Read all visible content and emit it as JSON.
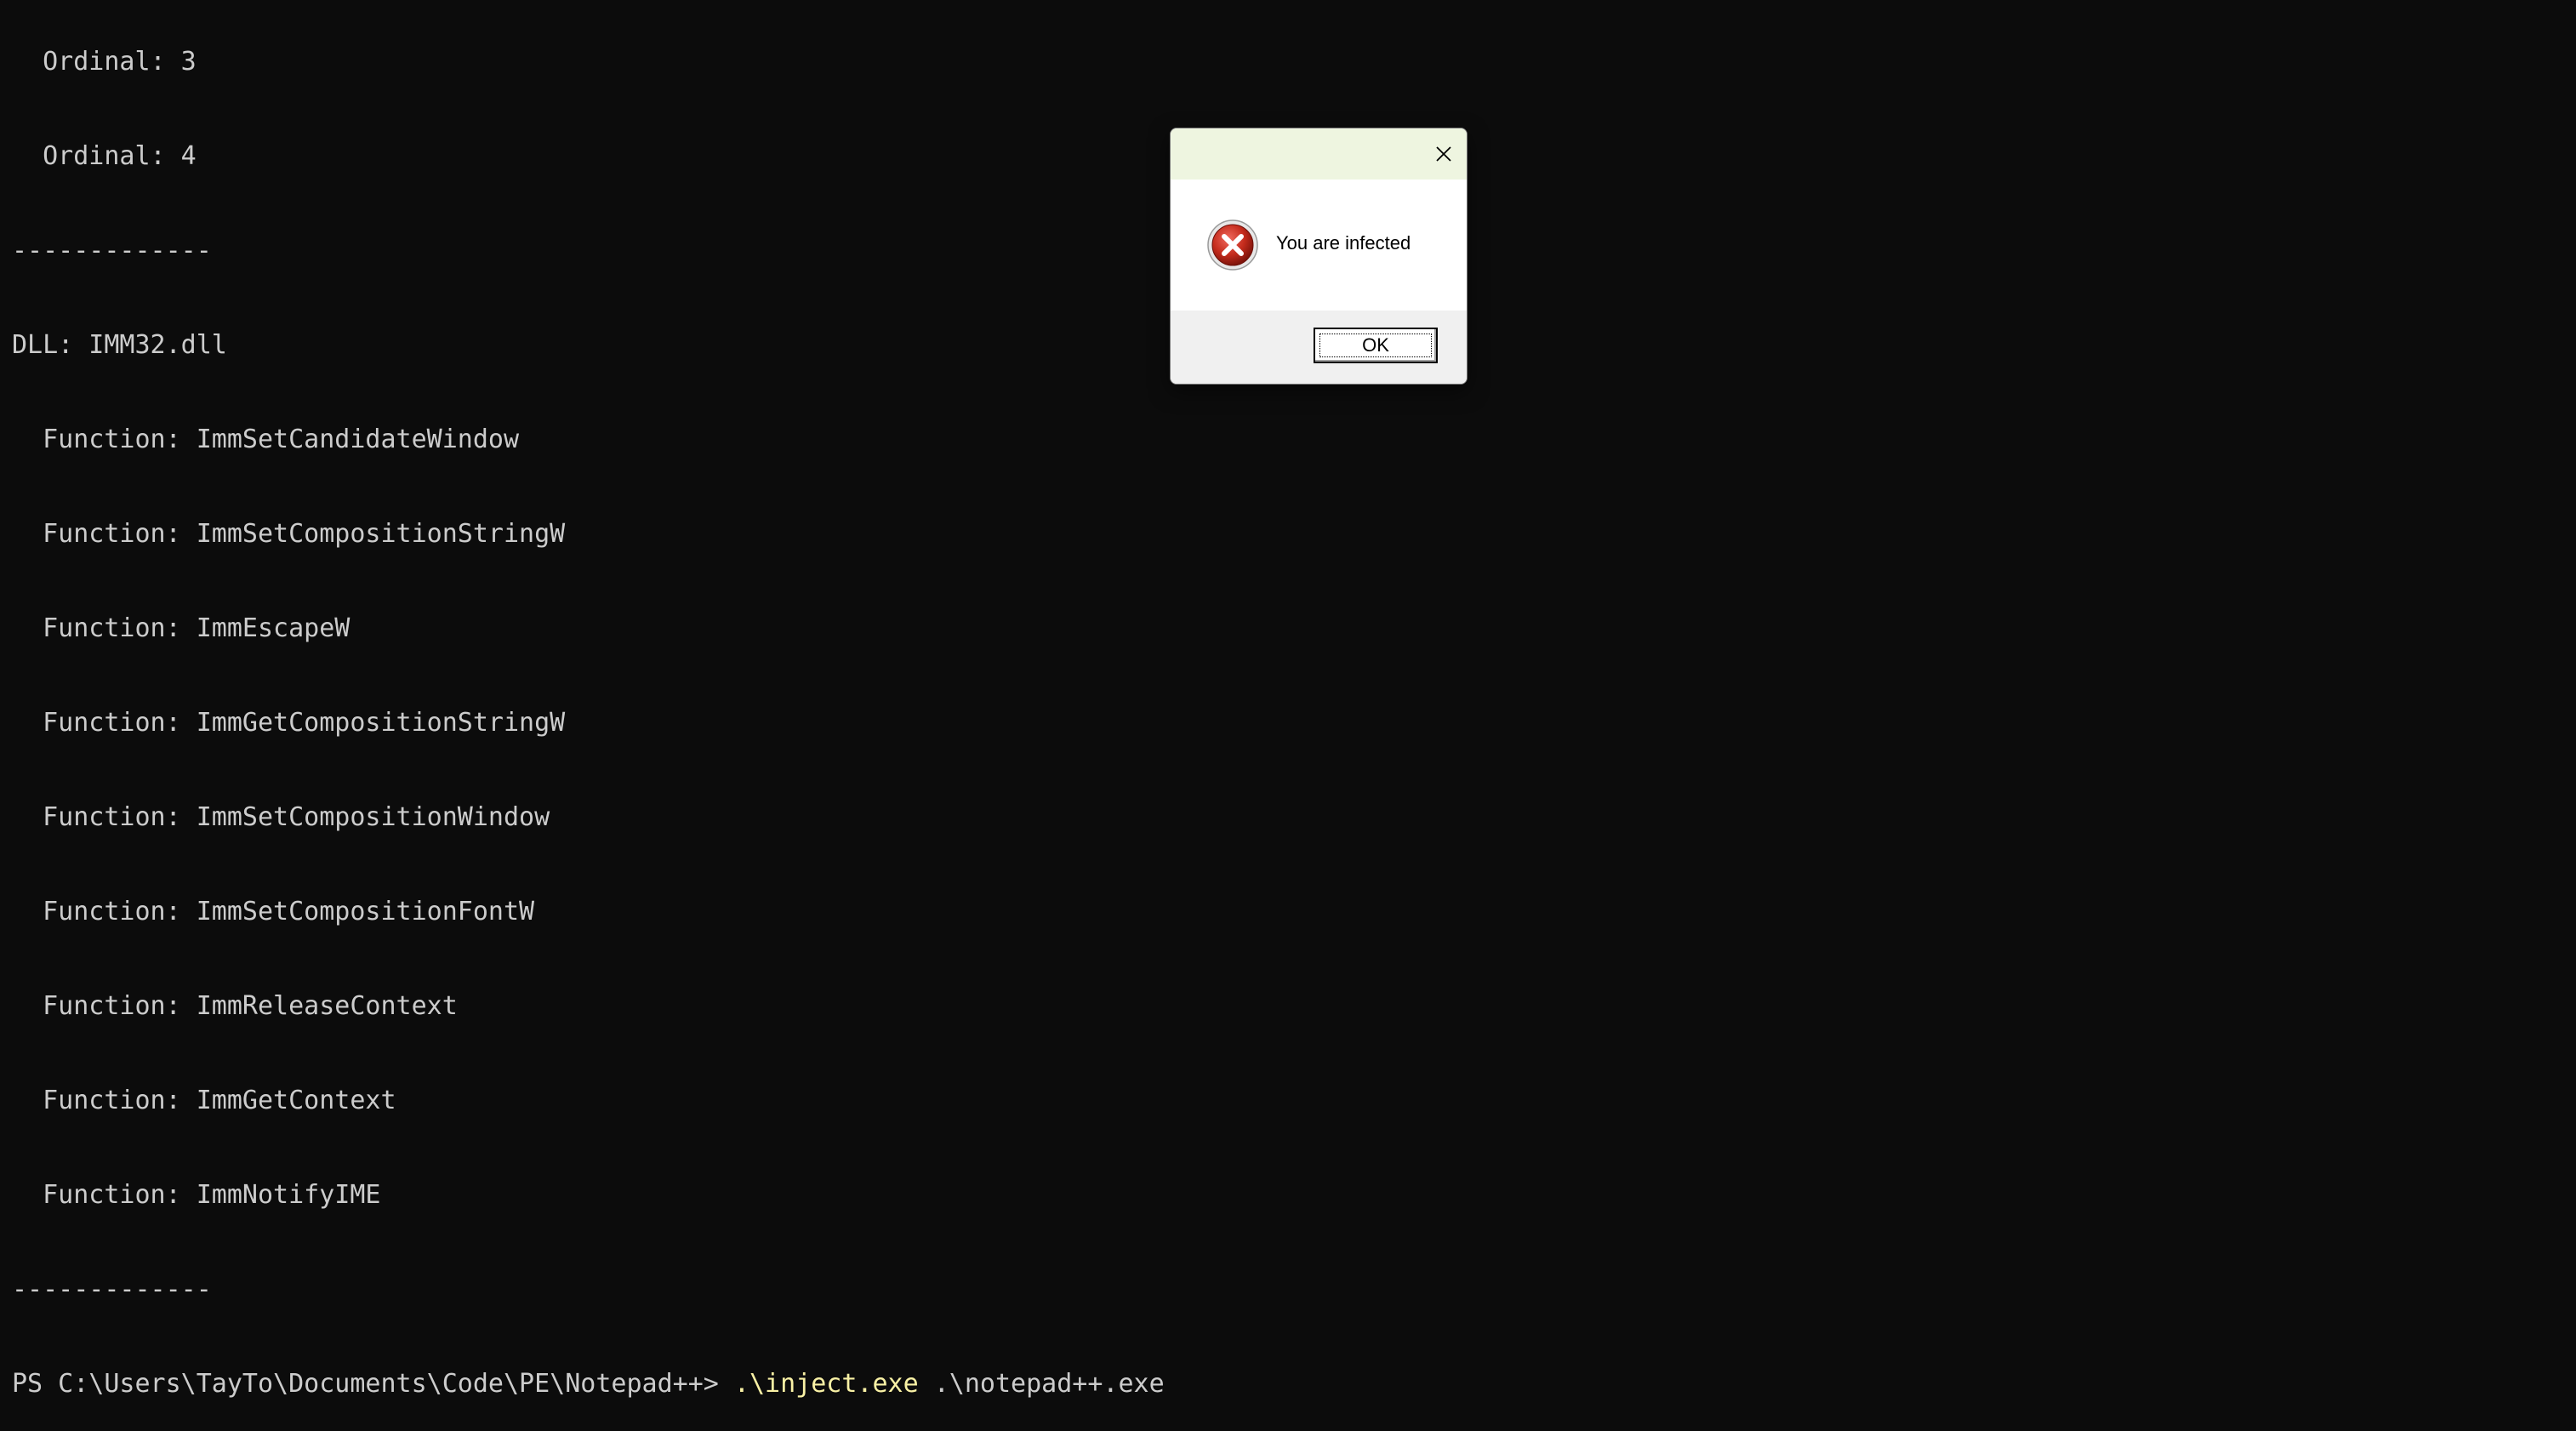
{
  "terminal": {
    "lines": [
      "  Ordinal: 3",
      "  Ordinal: 4",
      "-------------",
      "DLL: IMM32.dll",
      "  Function: ImmSetCandidateWindow",
      "  Function: ImmSetCompositionStringW",
      "  Function: ImmEscapeW",
      "  Function: ImmGetCompositionStringW",
      "  Function: ImmSetCompositionWindow",
      "  Function: ImmSetCompositionFontW",
      "  Function: ImmReleaseContext",
      "  Function: ImmGetContext",
      "  Function: ImmNotifyIME",
      "-------------"
    ],
    "prompt": {
      "path": "PS C:\\Users\\TayTo\\Documents\\Code\\PE\\Notepad++> ",
      "command": ".\\inject.exe",
      "argument": " .\\notepad++.exe"
    }
  },
  "dialog": {
    "message": "You are infected",
    "ok_label": "OK",
    "icon": "error-icon",
    "close_icon": "close-icon"
  },
  "colors": {
    "terminal_bg": "#0c0c0c",
    "terminal_fg": "#cccccc",
    "command_yellow": "#f9f1a5",
    "dialog_titlebar": "#eef5e0",
    "error_red": "#c42b1c"
  }
}
